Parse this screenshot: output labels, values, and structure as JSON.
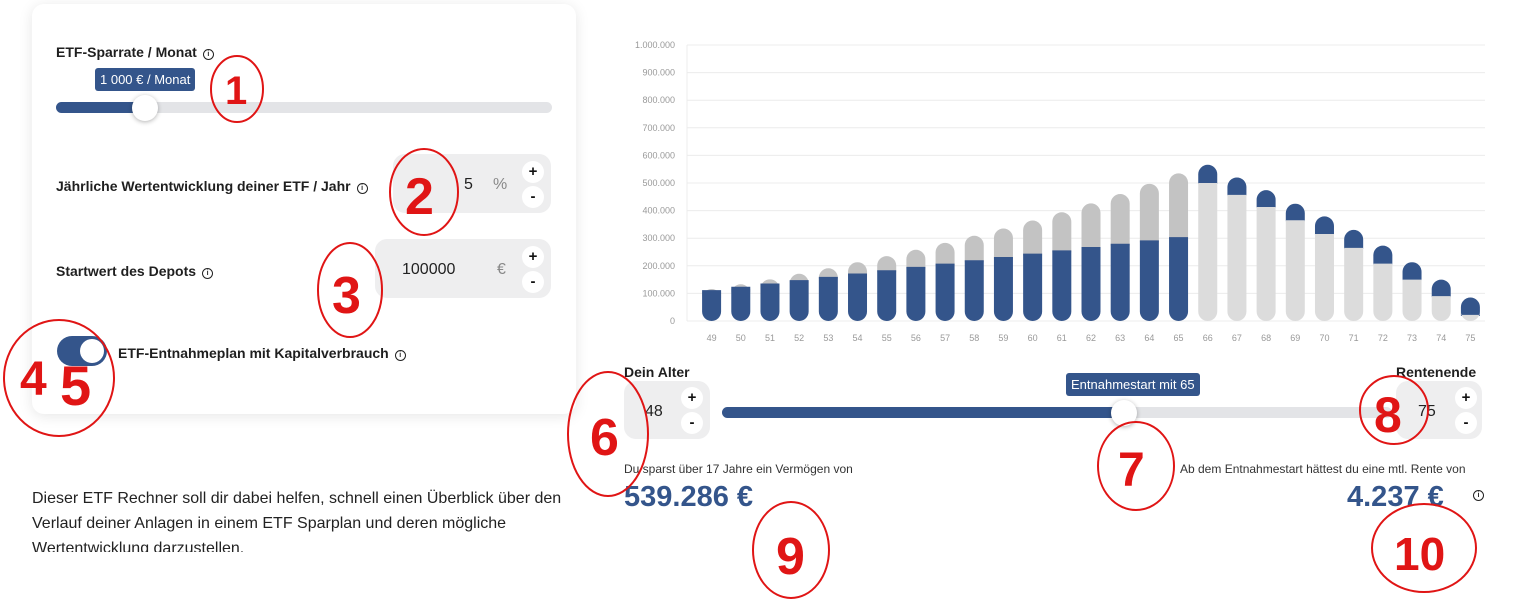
{
  "left_panel": {
    "savings_rate": {
      "label": "ETF-Sparrate / Monat",
      "tooltip": "1 000 € / Monat",
      "level": 0.18
    },
    "growth": {
      "label": "Jährliche Wertentwicklung deiner ETF / Jahr",
      "value": "5",
      "unit": "%",
      "plus": "+",
      "minus": "-"
    },
    "start_value": {
      "label": "Startwert des Depots",
      "value": "100000",
      "unit": "€",
      "plus": "+",
      "minus": "-"
    },
    "withdrawal_toggle": {
      "label": "ETF-Entnahmeplan mit Kapitalverbrauch",
      "checked": true
    }
  },
  "description": "Dieser ETF Rechner soll dir dabei helfen, schnell einen Überblick über den Verlauf deiner Anlagen in einem ETF Sparplan und deren mögliche Wertentwicklung darzustellen.",
  "age_controls": {
    "age_label": "Dein Alter",
    "age_value": "48",
    "end_label": "Rentenende",
    "end_value": "75",
    "plus": "+",
    "minus": "-",
    "slider_tooltip": "Entnahmestart mit 65",
    "slider_level": 0.6
  },
  "results": {
    "savings_text": "Du sparst über 17 Jahre ein Vermögen von",
    "savings_value": "539.286 €",
    "pension_text": "Ab dem Entnahmestart hättest du eine mtl. Rente von",
    "pension_value": "4.237 €"
  },
  "annotations": [
    "1",
    "2",
    "3",
    "4",
    "5",
    "6",
    "7",
    "8",
    "9",
    "10"
  ],
  "colors": {
    "accent": "#34558b",
    "saved_grey": "#c3c3c3",
    "withdraw_grey": "#dcdcdc",
    "annotation_red": "#e01515"
  },
  "chart_data": {
    "type": "bar",
    "stacked": true,
    "categories": [
      "49",
      "50",
      "51",
      "52",
      "53",
      "54",
      "55",
      "56",
      "57",
      "58",
      "59",
      "60",
      "61",
      "62",
      "63",
      "64",
      "65",
      "66",
      "67",
      "68",
      "69",
      "70",
      "71",
      "72",
      "73",
      "74",
      "75"
    ],
    "y_tick_labels": [
      "0",
      "100.000",
      "200.000",
      "300.000",
      "400.000",
      "500.000",
      "600.000",
      "700.000",
      "800.000",
      "900.000",
      "1.000.000"
    ],
    "ylim": [
      0,
      1000000
    ],
    "grid": true,
    "accumulation_phase": {
      "blue": [
        112000,
        124000,
        136000,
        148000,
        160000,
        172000,
        184000,
        196000,
        208000,
        220000,
        232000,
        244000,
        256000,
        268000,
        280000,
        292000,
        304000
      ],
      "grey_total": [
        116000,
        133000,
        151000,
        171000,
        191000,
        213000,
        235000,
        258000,
        283000,
        309000,
        335000,
        364000,
        394000,
        426000,
        460000,
        497000,
        535000
      ]
    },
    "withdrawal_phase": {
      "total": [
        566000,
        520000,
        474000,
        425000,
        379000,
        330000,
        273000,
        213000,
        150000,
        85000
      ],
      "grey": [
        500000,
        457000,
        413000,
        365000,
        315000,
        265000,
        208000,
        150000,
        90000,
        22000
      ]
    }
  }
}
